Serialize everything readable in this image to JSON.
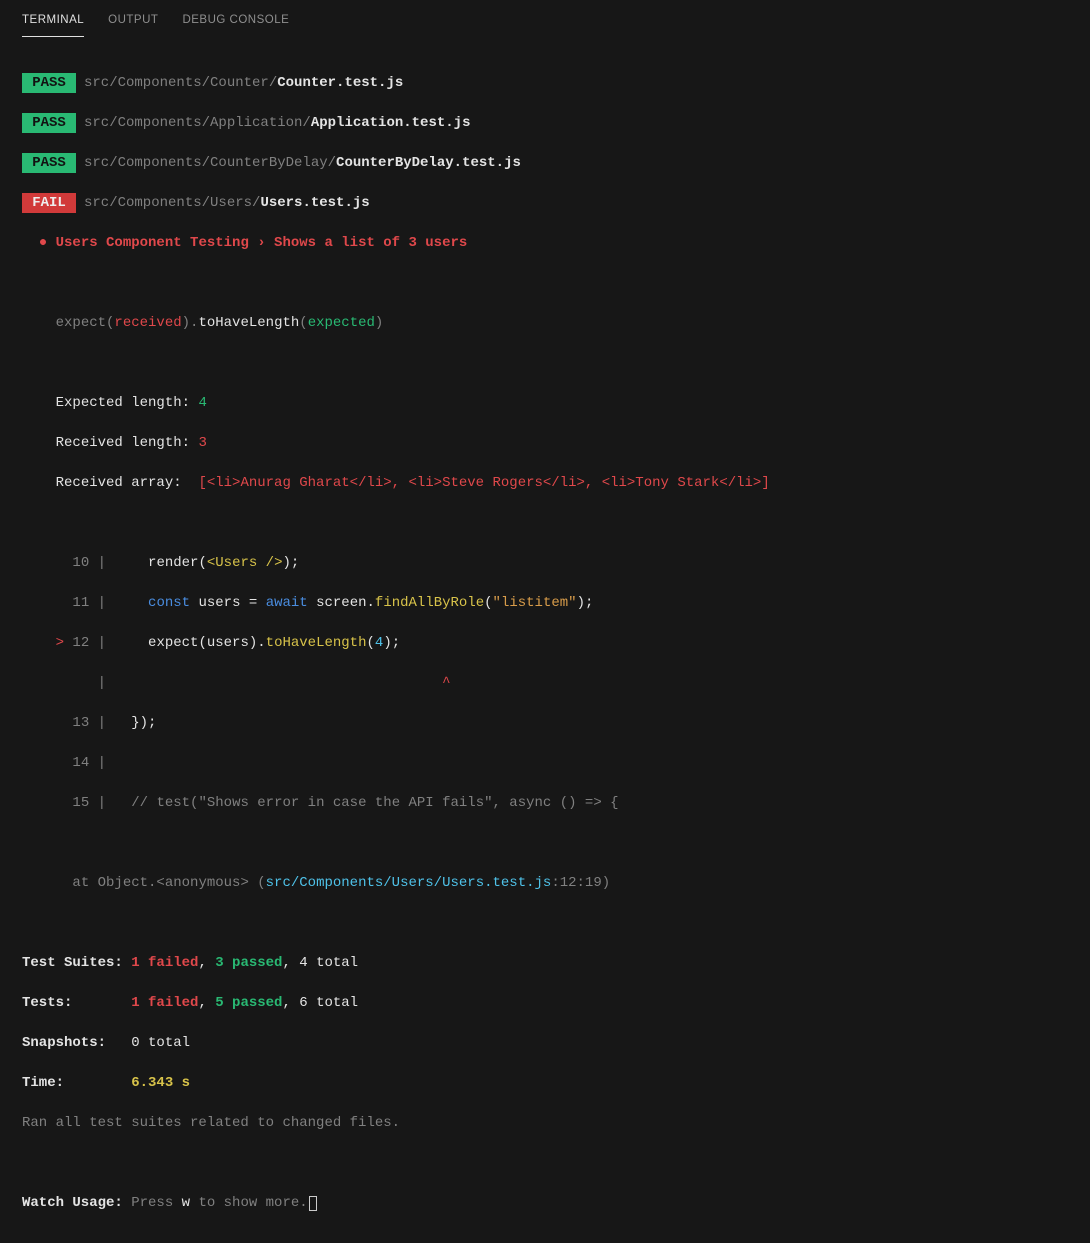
{
  "tabs": {
    "terminal": "TERMINAL",
    "output": "OUTPUT",
    "debug": "DEBUG CONSOLE"
  },
  "badges": {
    "pass": "PASS",
    "fail": "FAIL"
  },
  "files": {
    "f1_path": "src/Components/Counter/",
    "f1_name": "Counter.test.js",
    "f2_path": "src/Components/Application/",
    "f2_name": "Application.test.js",
    "f3_path": "src/Components/CounterByDelay/",
    "f3_name": "CounterByDelay.test.js",
    "f4_path": "src/Components/Users/",
    "f4_name": "Users.test.js"
  },
  "fail_title": "● Users Component Testing › Shows a list of 3 users",
  "expect_line": {
    "a": "expect(",
    "b": "received",
    "c": ").",
    "d": "toHaveLength",
    "e": "(",
    "f": "expected",
    "g": ")"
  },
  "expected_len": {
    "label": "Expected length: ",
    "val": "4"
  },
  "received_len": {
    "label": "Received length: ",
    "val": "3"
  },
  "received_arr": {
    "label": "Received array:  ",
    "val": "[<li>Anurag Gharat</li>, <li>Steve Rogers</li>, <li>Tony Stark</li>]"
  },
  "code": {
    "l10_num": "10",
    "l10_a": "render(",
    "l10_b": "<Users />",
    "l10_c": ");",
    "l11_num": "11",
    "l11_a": "const",
    "l11_b": " users = ",
    "l11_c": "await",
    "l11_d": " screen.",
    "l11_e": "findAllByRole",
    "l11_f": "(",
    "l11_g": "\"listitem\"",
    "l11_h": ");",
    "l12_marker": ">",
    "l12_num": "12",
    "l12_a": "expect(users).",
    "l12_b": "toHaveLength",
    "l12_c": "(",
    "l12_d": "4",
    "l12_e": ");",
    "caret_line": "                                       ",
    "caret": "^",
    "l13_num": "13",
    "l13_a": "});",
    "l14_num": "14",
    "l15_num": "15",
    "l15_a": "// test(\"Shows error in case the API fails\", async () => {"
  },
  "traceback": {
    "a": "at Object.<anonymous> (",
    "b": "src/Components/Users/Users.test.js",
    "c": ":12:19)"
  },
  "summary": {
    "suites_label": "Test Suites: ",
    "suites_fail": "1 failed",
    "suites_sep1": ", ",
    "suites_pass": "3 passed",
    "suites_sep2": ", 4 total",
    "tests_label": "Tests:       ",
    "tests_fail": "1 failed",
    "tests_sep1": ", ",
    "tests_pass": "5 passed",
    "tests_sep2": ", 6 total",
    "snap_label": "Snapshots:   ",
    "snap_val": "0 total",
    "time_label": "Time:        ",
    "time_val": "6.343 s",
    "ran": "Ran all test suites related to changed files."
  },
  "watch": {
    "label": "Watch Usage:",
    "a": " Press ",
    "key": "w",
    "b": " to show more."
  }
}
